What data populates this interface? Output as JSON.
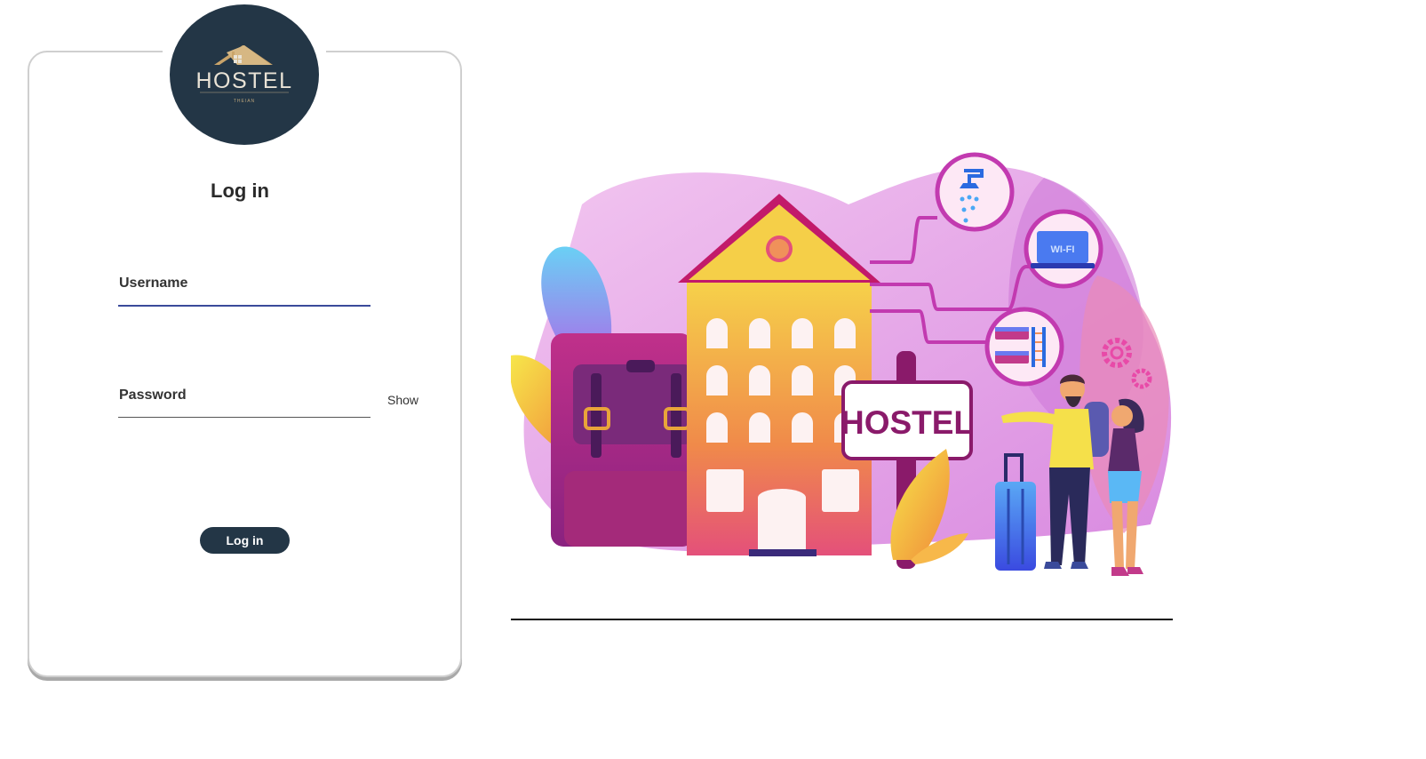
{
  "logo": {
    "wordmark": "HOSTEL",
    "tagline": "THEIAN"
  },
  "login_form": {
    "title": "Log in",
    "username_label": "Username",
    "password_label": "Password",
    "show_password_label": "Show",
    "submit_label": "Log in"
  },
  "illustration": {
    "sign_text": "HOSTEL",
    "wifi_text": "WI-FI"
  },
  "colors": {
    "brand_dark": "#233646",
    "logo_gold": "#c9a46a",
    "username_underline": "#3a4a9a",
    "password_underline": "#555555"
  }
}
